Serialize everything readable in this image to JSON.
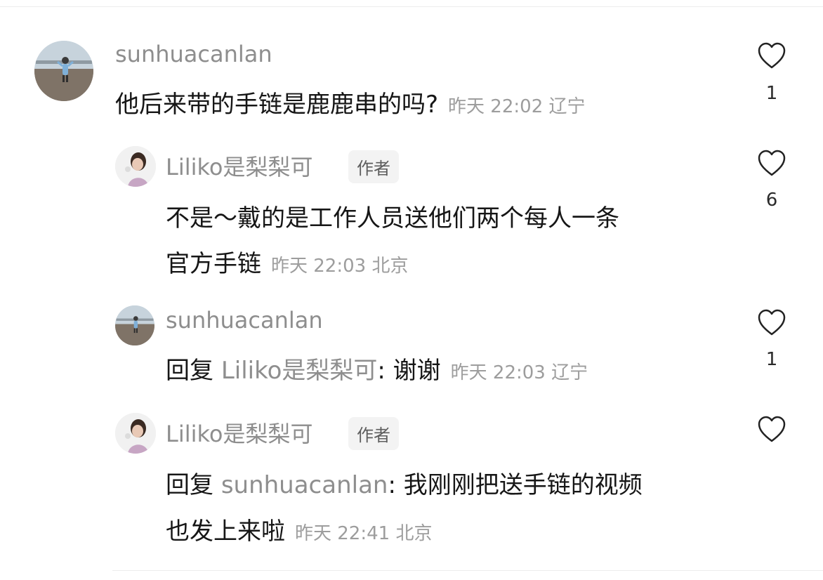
{
  "comments": [
    {
      "username": "sunhuacanlan",
      "lines": [
        "他后来带的手链是鹿鹿串的吗?"
      ],
      "time": "昨天 22:02 辽宁",
      "likes": "1",
      "avatar": "landscape-avatar"
    },
    {
      "username": "Liliko是梨梨可",
      "badge": "作者",
      "lines": [
        "不是～戴的是工作人员送他们两个每人一条",
        "官方手链"
      ],
      "time": "昨天 22:03 北京",
      "likes": "6",
      "avatar": "girl-avatar"
    },
    {
      "username": "sunhuacanlan",
      "reply_prefix": "回复",
      "reply_to": "Liliko是梨梨可",
      "lines": [
        ": 谢谢"
      ],
      "time": "昨天 22:03 辽宁",
      "likes": "1",
      "avatar": "landscape-avatar"
    },
    {
      "username": "Liliko是梨梨可",
      "badge": "作者",
      "reply_prefix": "回复",
      "reply_to": "sunhuacanlan",
      "lines": [
        ": 我刚刚把送手链的视频",
        "也发上来啦"
      ],
      "time": "昨天 22:41 北京",
      "likes": "",
      "avatar": "girl-avatar"
    }
  ],
  "colors": {
    "username": "#8e8e8e",
    "text": "#161616",
    "meta": "#9d9d9d",
    "badge_bg": "#f3f3f3"
  }
}
